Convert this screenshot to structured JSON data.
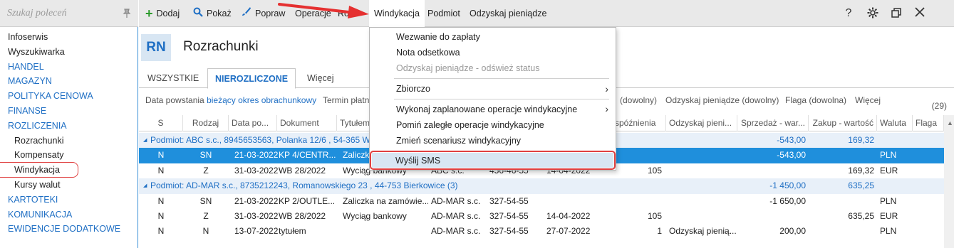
{
  "sidebar": {
    "search_placeholder": "Szukaj poleceń",
    "items": [
      {
        "label": "Infoserwis",
        "kind": "plain"
      },
      {
        "label": "Wyszukiwarka",
        "kind": "plain"
      },
      {
        "label": "HANDEL",
        "kind": "section"
      },
      {
        "label": "MAGAZYN",
        "kind": "section"
      },
      {
        "label": "POLITYKA CENOWA",
        "kind": "section"
      },
      {
        "label": "FINANSE",
        "kind": "section"
      },
      {
        "label": "ROZLICZENIA",
        "kind": "section"
      },
      {
        "label": "Rozrachunki",
        "kind": "sub"
      },
      {
        "label": "Kompensaty",
        "kind": "sub"
      },
      {
        "label": "Windykacja",
        "kind": "sub"
      },
      {
        "label": "Kursy walut",
        "kind": "sub"
      },
      {
        "label": "KARTOTEKI",
        "kind": "section"
      },
      {
        "label": "KOMUNIKACJA",
        "kind": "section"
      },
      {
        "label": "EWIDENCJE DODATKOWE",
        "kind": "section"
      }
    ]
  },
  "toolbar": {
    "add": "Dodaj",
    "show": "Pokaż",
    "edit": "Popraw",
    "operations": "Operacje",
    "ro": "Ro",
    "windykacja": "Windykacja",
    "podmiot": "Podmiot",
    "recover": "Odzyskaj pieniądze"
  },
  "header": {
    "badge": "RN",
    "title": "Rozrachunki"
  },
  "tabs": [
    "WSZYSTKIE",
    "NIEROZLICZONE",
    "Więcej"
  ],
  "filters": {
    "date_label": "Data powstania",
    "date_value": "bieżący okres obrachunkowy",
    "term": "Termin płatn",
    "any1": "(dowolny)",
    "recover_filter": "Odzyskaj pieniądze (dowolny)",
    "flag_filter": "Flaga (dowolna)",
    "more": "Więcej",
    "count": "(29)"
  },
  "grid": {
    "columns": [
      "S",
      "Rodzaj",
      "Data po...",
      "Dokument",
      "Tytułem",
      "spóźnienia",
      "Odzyskaj pieni...",
      "Sprzedaż - war...",
      "Zakup - wartość",
      "Waluta",
      "Flaga"
    ],
    "groups": [
      {
        "label": "Podmiot: ABC s.c., 8945653563, Polanka  12/6 , 54-365 Wro",
        "sale": "-543,00",
        "buy": "169,32",
        "rows": [
          {
            "s": "N",
            "kind": "SN",
            "date": "21-03-2022",
            "doc": "KP 4/CENTR...",
            "title": "Zaliczk",
            "party": "",
            "nip": "",
            "due": "",
            "late": "",
            "recover": "",
            "sale": "-543,00",
            "buy": "",
            "cur": "PLN",
            "selected": true
          },
          {
            "s": "N",
            "kind": "Z",
            "date": "31-03-2022",
            "doc": "WB 28/2022",
            "title": "Wyciąg bankowy",
            "party": "ABC s.c.",
            "nip": "456-46-55",
            "due": "14-04-2022",
            "late": "105",
            "recover": "",
            "sale": "",
            "buy": "169,32",
            "cur": "EUR",
            "selected": false
          }
        ]
      },
      {
        "label": "Podmiot: AD-MAR s.c., 8735212243, Romanowskiego 23 , 44-753 Bierkowice (3)",
        "sale": "-1 450,00",
        "buy": "635,25",
        "rows": [
          {
            "s": "N",
            "kind": "SN",
            "date": "21-03-2022",
            "doc": "KP 2/OUTLE...",
            "title": "Zaliczka na zamówie...",
            "party": "AD-MAR s.c.",
            "nip": "327-54-55",
            "due": "",
            "late": "",
            "recover": "",
            "sale": "-1 650,00",
            "buy": "",
            "cur": "PLN",
            "selected": false
          },
          {
            "s": "N",
            "kind": "Z",
            "date": "31-03-2022",
            "doc": "WB 28/2022",
            "title": "Wyciąg bankowy",
            "party": "AD-MAR s.c.",
            "nip": "327-54-55",
            "due": "14-04-2022",
            "late": "105",
            "recover": "",
            "sale": "",
            "buy": "635,25",
            "cur": "EUR",
            "selected": false
          },
          {
            "s": "N",
            "kind": "N",
            "date": "13-07-2022",
            "doc": "tytułem",
            "title": "",
            "party": "AD-MAR s.c.",
            "nip": "327-54-55",
            "due": "27-07-2022",
            "late": "1",
            "recover": "Odzyskaj pienią...",
            "sale": "200,00",
            "buy": "",
            "cur": "PLN",
            "selected": false
          }
        ]
      }
    ]
  },
  "menu": {
    "items": [
      {
        "label": "Wezwanie do zapłaty"
      },
      {
        "label": "Nota odsetkowa"
      },
      {
        "label": "Odzyskaj pieniądze - odśwież status"
      },
      {
        "label": "Zbiorczo"
      },
      {
        "label": "Wykonaj zaplanowane operacje windykacyjne"
      },
      {
        "label": "Pomiń zaległe operacje windykacyjne"
      },
      {
        "label": "Zmień scenariusz windykacyjny"
      },
      {
        "label": "Wyślij SMS"
      }
    ]
  },
  "colors": {
    "accent": "#1f6fc4",
    "selection": "#1f8fdc",
    "highlight": "#e04040",
    "add": "#2c9b2c"
  }
}
